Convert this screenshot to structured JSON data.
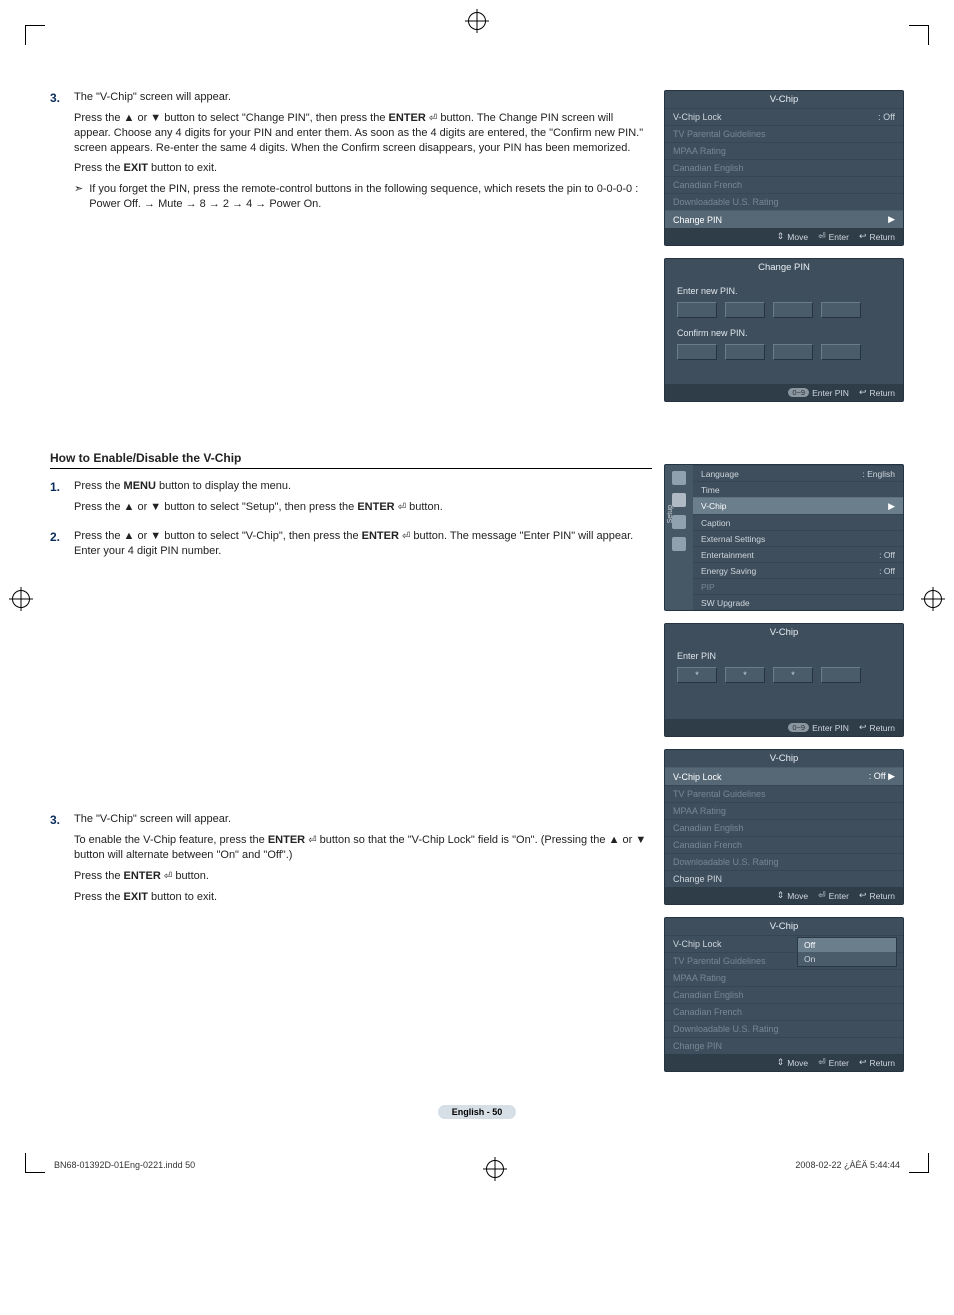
{
  "reg_icon": "⊕",
  "step3a": {
    "num": "3.",
    "line1": "The \"V-Chip\" screen will appear.",
    "line2a": "Press the ▲ or ▼ button to select \"Change PIN\", then press the ",
    "enter_label": "ENTER",
    "enter_icon": "⏎",
    "line2b": " button. The Change PIN screen will appear. Choose any 4 digits for your PIN and enter them. As soon as the 4 digits are entered, the \"Confirm new PIN.\" screen appears. Re-enter the same 4 digits. When the Confirm screen disappears, your PIN has been memorized.",
    "line3a": "Press the ",
    "exit_label": "EXIT",
    "line3b": " button to exit.",
    "note_icon": "➣",
    "note": "If you forget the PIN, press the remote-control buttons in the following sequence, which resets the pin to 0-0-0-0 : Power Off. → Mute → 8 → 2 → 4 → Power On."
  },
  "section_title": "How to Enable/Disable the V-Chip",
  "step1": {
    "num": "1.",
    "line1a": "Press the ",
    "menu_label": "MENU",
    "line1b": " button to display the menu.",
    "line2a": "Press the ▲ or ▼ button to select \"Setup\", then press the ",
    "enter_label": "ENTER",
    "line2b": " button."
  },
  "step2": {
    "num": "2.",
    "line1a": "Press the ▲ or ▼ button to select \"V-Chip\", then press the ",
    "enter_label": "ENTER",
    "line1b": " button. The message \"Enter PIN\" will appear. Enter your 4 digit PIN number."
  },
  "step3b": {
    "num": "3.",
    "line1": "The \"V-Chip\" screen will appear.",
    "line2a": "To enable the V-Chip feature, press the ",
    "enter_label": "ENTER",
    "line2b": " button so that the \"V-Chip Lock\" field is \"On\". (Pressing the ▲ or ▼ button will alternate between \"On\" and \"Off\".)",
    "line3a": "Press the ",
    "line3b": " button.",
    "line4a": "Press the ",
    "exit_label": "EXIT",
    "line4b": " button to exit."
  },
  "osd_vchip1": {
    "title": "V-Chip",
    "items": [
      {
        "label": "V-Chip Lock",
        "value": ": Off",
        "dim": false,
        "hl": false
      },
      {
        "label": "TV Parental Guidelines",
        "value": "",
        "dim": true
      },
      {
        "label": "MPAA Rating",
        "value": "",
        "dim": true
      },
      {
        "label": "Canadian English",
        "value": "",
        "dim": true
      },
      {
        "label": "Canadian French",
        "value": "",
        "dim": true
      },
      {
        "label": "Downloadable U.S. Rating",
        "value": "",
        "dim": true
      },
      {
        "label": "Change PIN",
        "value": "",
        "dim": false,
        "hl": true,
        "arrow": true
      }
    ],
    "foot": {
      "move": "Move",
      "enter": "Enter",
      "return": "Return",
      "move_icon": "⇕",
      "enter_icon": "⏎",
      "return_icon": "↩"
    }
  },
  "osd_changepin": {
    "title": "Change PIN",
    "enter_label": "Enter new PIN.",
    "confirm_label": "Confirm new PIN.",
    "foot": {
      "pill": "0~9",
      "enterpin": "Enter PIN",
      "return": "Return",
      "return_icon": "↩"
    }
  },
  "osd_setup": {
    "side_label": "Setup",
    "items": [
      {
        "label": "Language",
        "value": ": English"
      },
      {
        "label": "Time",
        "value": ""
      },
      {
        "label": "V-Chip",
        "value": "",
        "hl": true,
        "arrow": true
      },
      {
        "label": "Caption",
        "value": ""
      },
      {
        "label": "External Settings",
        "value": ""
      },
      {
        "label": "Entertainment",
        "value": ": Off"
      },
      {
        "label": "Energy Saving",
        "value": ": Off"
      },
      {
        "label": "PIP",
        "value": "",
        "dim": true
      },
      {
        "label": "SW Upgrade",
        "value": ""
      }
    ]
  },
  "osd_enterpin": {
    "title": "V-Chip",
    "label": "Enter PIN",
    "filled": 3,
    "foot": {
      "pill": "0~9",
      "enterpin": "Enter PIN",
      "return": "Return",
      "return_icon": "↩"
    }
  },
  "osd_vchip2": {
    "title": "V-Chip",
    "items": [
      {
        "label": "V-Chip Lock",
        "value": ": Off",
        "hl": true,
        "arrow": true
      },
      {
        "label": "TV Parental Guidelines",
        "value": "",
        "dim": true
      },
      {
        "label": "MPAA Rating",
        "value": "",
        "dim": true
      },
      {
        "label": "Canadian English",
        "value": "",
        "dim": true
      },
      {
        "label": "Canadian French",
        "value": "",
        "dim": true
      },
      {
        "label": "Downloadable U.S. Rating",
        "value": "",
        "dim": true
      },
      {
        "label": "Change PIN",
        "value": ""
      }
    ],
    "foot": {
      "move": "Move",
      "enter": "Enter",
      "return": "Return",
      "move_icon": "⇕",
      "enter_icon": "⏎",
      "return_icon": "↩"
    }
  },
  "osd_vchip3": {
    "title": "V-Chip",
    "items": [
      {
        "label": "V-Chip Lock",
        "value": ":"
      },
      {
        "label": "TV Parental Guidelines",
        "value": "",
        "dim": true
      },
      {
        "label": "MPAA Rating",
        "value": "",
        "dim": true
      },
      {
        "label": "Canadian English",
        "value": "",
        "dim": true
      },
      {
        "label": "Canadian French",
        "value": "",
        "dim": true
      },
      {
        "label": "Downloadable U.S. Rating",
        "value": "",
        "dim": true
      },
      {
        "label": "Change PIN",
        "value": "",
        "dim": true
      }
    ],
    "dropdown": {
      "opts": [
        "Off",
        "On"
      ],
      "hl": 0
    },
    "foot": {
      "move": "Move",
      "enter": "Enter",
      "return": "Return",
      "move_icon": "⇕",
      "enter_icon": "⏎",
      "return_icon": "↩"
    }
  },
  "page_foot": "English - 50",
  "meta_left": "BN68-01392D-01Eng-0221.indd   50",
  "meta_right": "2008-02-22   ¿ÀÈÄ 5:44:44"
}
